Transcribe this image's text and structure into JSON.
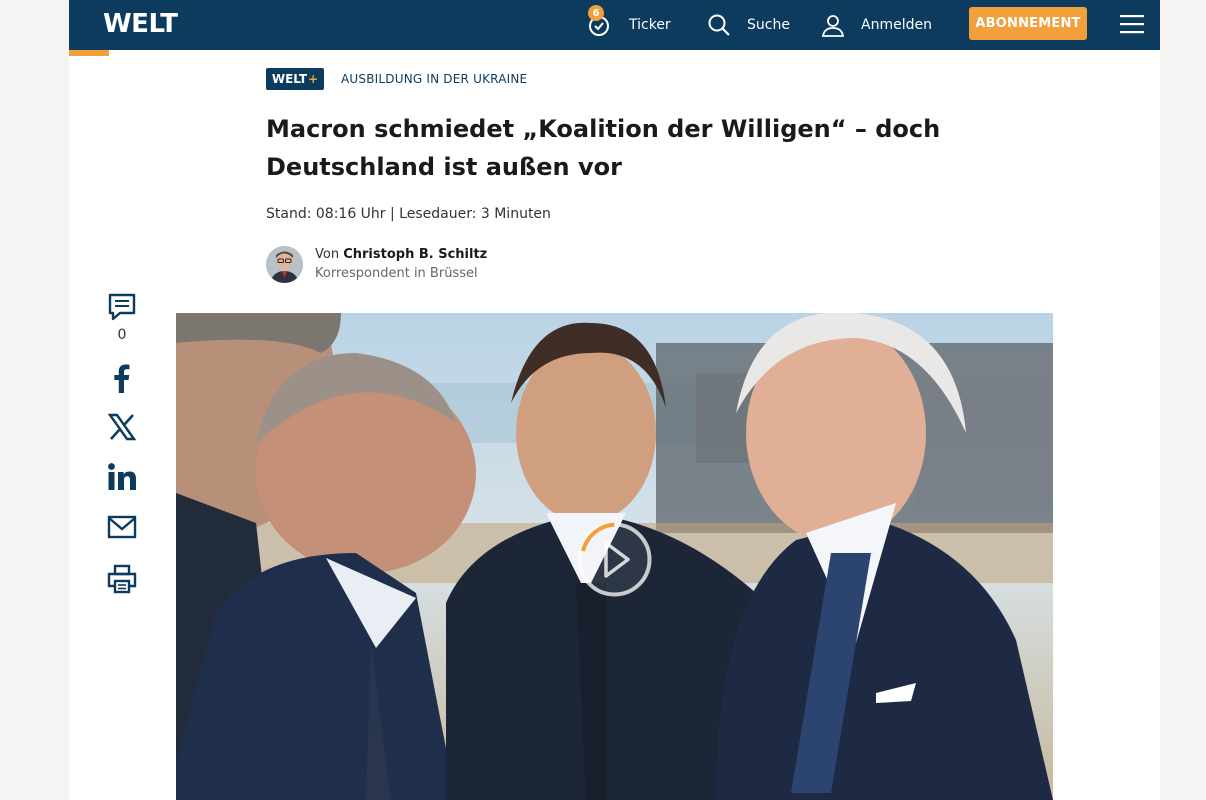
{
  "header": {
    "logo": "WELT",
    "ticker": {
      "count": "6",
      "label": "Ticker"
    },
    "search_label": "Suche",
    "login_label": "Anmelden",
    "subscribe_label": "ABONNEMENT"
  },
  "article": {
    "premium_badge": {
      "text": "WELT",
      "plus": "+"
    },
    "kicker": "AUSBILDUNG IN DER UKRAINE",
    "headline": "Macron schmiedet „Koalition der Willigen“ – doch Deutschland ist außen vor",
    "meta": "Stand: 08:16 Uhr | Lesedauer: 3 Minuten",
    "author": {
      "prefix": "Von ",
      "name": "Christoph B. Schiltz",
      "role": "Korrespondent in Brüssel"
    }
  },
  "share": {
    "comment_count": "0",
    "icons": [
      "comment-icon",
      "facebook-icon",
      "x-icon",
      "linkedin-icon",
      "mail-icon",
      "print-icon"
    ]
  },
  "colors": {
    "brand_navy": "#0d3b5e",
    "accent_orange": "#f2a03c"
  }
}
